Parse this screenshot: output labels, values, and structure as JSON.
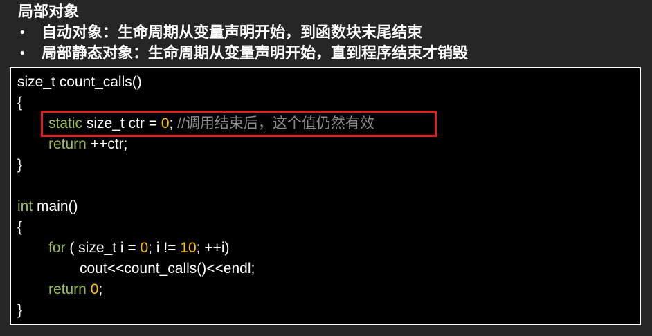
{
  "title": "局部对象",
  "bullets": [
    {
      "symbol": "•",
      "text": "自动对象：生命周期从变量声明开始，到函数块末尾结束"
    },
    {
      "symbol": "•",
      "text": "局部静态对象：生命周期从变量声明开始，直到程序结束才销毁"
    }
  ],
  "code": {
    "line1": {
      "text": "size_t count_calls()"
    },
    "line2": {
      "text": "{"
    },
    "line3": {
      "kw": "static",
      "mid": " size_t ctr = ",
      "num": "0",
      "end": "; ",
      "comment": "//调用结束后，这个值仍然有效"
    },
    "line4": {
      "kw": "return",
      "rest": " ++ctr;"
    },
    "line5": {
      "text": "}"
    },
    "line7": {
      "kw": "int",
      "rest": " main()"
    },
    "line8": {
      "text": "{"
    },
    "line9": {
      "kw": "for",
      "a": " ( size_t i = ",
      "num1": "0",
      "b": "; i != ",
      "num2": "10",
      "c": "; ++i)"
    },
    "line10": {
      "text": "cout<<count_calls()<<endl;"
    },
    "line11": {
      "kw": "return",
      "mid": " ",
      "num": "0",
      "end": ";"
    },
    "line12": {
      "text": "}"
    }
  },
  "colors": {
    "background": "#262626",
    "code_background": "#000000",
    "keyword": "#9bbb59",
    "number": "#ffc000",
    "comment": "#8c8c8c",
    "highlight_border": "#e0201c"
  }
}
